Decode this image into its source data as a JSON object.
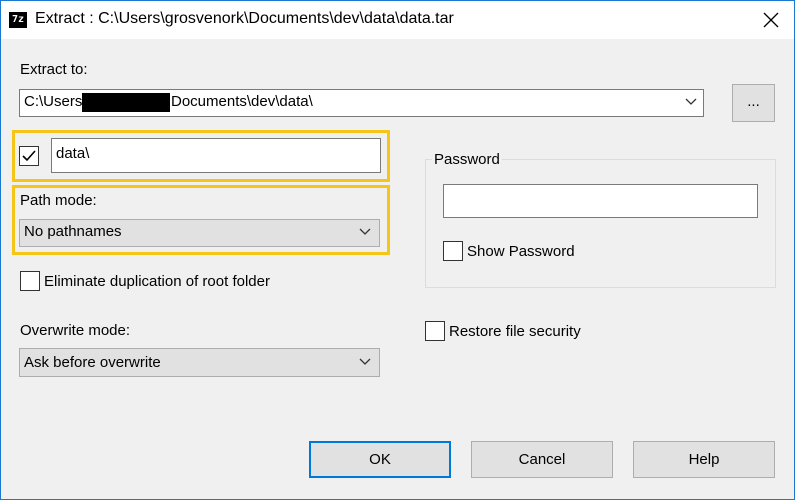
{
  "window": {
    "title": "Extract : C:\\Users\\grosvenork\\Documents\\dev\\data\\data.tar",
    "app_icon_text": "7z"
  },
  "extract_to": {
    "label": "Extract to:",
    "path_prefix": "C:\\Users",
    "path_suffix": "Documents\\dev\\data\\",
    "browse_label": "..."
  },
  "subfolder": {
    "checked": true,
    "value": "data\\"
  },
  "path_mode": {
    "label": "Path mode:",
    "selected": "No pathnames"
  },
  "eliminate_duplication": {
    "label": "Eliminate duplication of root folder",
    "checked": false
  },
  "overwrite_mode": {
    "label": "Overwrite mode:",
    "selected": "Ask before overwrite"
  },
  "password": {
    "group_label": "Password",
    "value": "",
    "show_password_label": "Show Password",
    "show_password_checked": false
  },
  "restore_security": {
    "label": "Restore file security",
    "checked": false
  },
  "buttons": {
    "ok": "OK",
    "cancel": "Cancel",
    "help": "Help"
  },
  "colors": {
    "highlight": "#f5c518",
    "accent": "#0078d7"
  }
}
